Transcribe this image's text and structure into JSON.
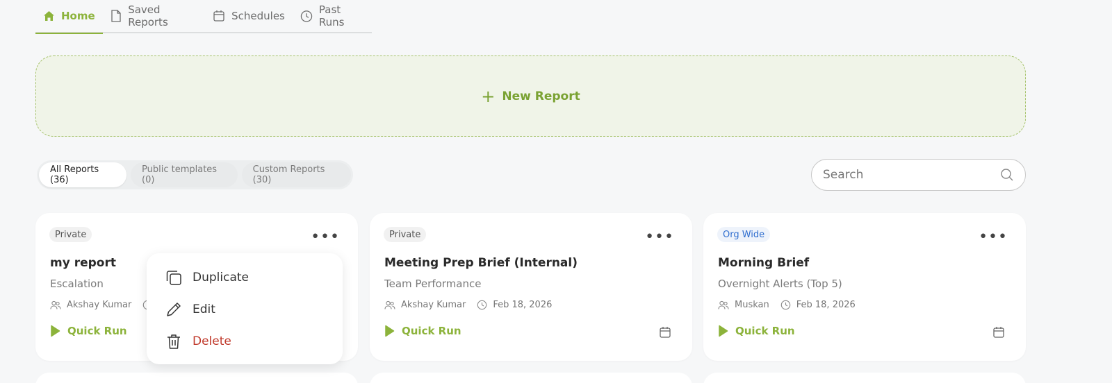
{
  "nav": {
    "tabs": [
      {
        "label": "Home",
        "icon": "home-icon"
      },
      {
        "label": "Saved Reports",
        "icon": "document-icon"
      },
      {
        "label": "Schedules",
        "icon": "calendar-icon"
      },
      {
        "label": "Past Runs",
        "icon": "clock-icon"
      }
    ],
    "active_tab": "Home"
  },
  "new_report": {
    "label": "New Report",
    "icon": "plus-icon"
  },
  "filters": {
    "chips": [
      {
        "label": "All Reports (36)"
      },
      {
        "label": "Public templates (0)"
      },
      {
        "label": "Custom Reports (30)"
      }
    ],
    "active": "All Reports (36)"
  },
  "search": {
    "placeholder": "Search",
    "value": ""
  },
  "cards": [
    {
      "badge": "Private",
      "title": "my report",
      "subtitle": "Escalation",
      "owner": "Akshay Kumar",
      "date": "",
      "run_label": "Quick Run"
    },
    {
      "badge": "Private",
      "title": "Meeting Prep Brief (Internal)",
      "subtitle": "Team Performance",
      "owner": "Akshay Kumar",
      "date": "Feb 18, 2026",
      "run_label": "Quick Run"
    },
    {
      "badge": "Org Wide",
      "title": "Morning Brief",
      "subtitle": "Overnight Alerts (Top 5)",
      "owner": "Muskan",
      "date": "Feb 18, 2026",
      "run_label": "Quick Run"
    }
  ],
  "context_menu": {
    "items": [
      {
        "label": "Duplicate",
        "icon": "copy-icon"
      },
      {
        "label": "Edit",
        "icon": "pencil-icon"
      },
      {
        "label": "Delete",
        "icon": "trash-icon"
      }
    ]
  },
  "colors": {
    "accent": "#8cb33b",
    "org_badge": "#2f6ecf",
    "danger": "#c0392b"
  }
}
